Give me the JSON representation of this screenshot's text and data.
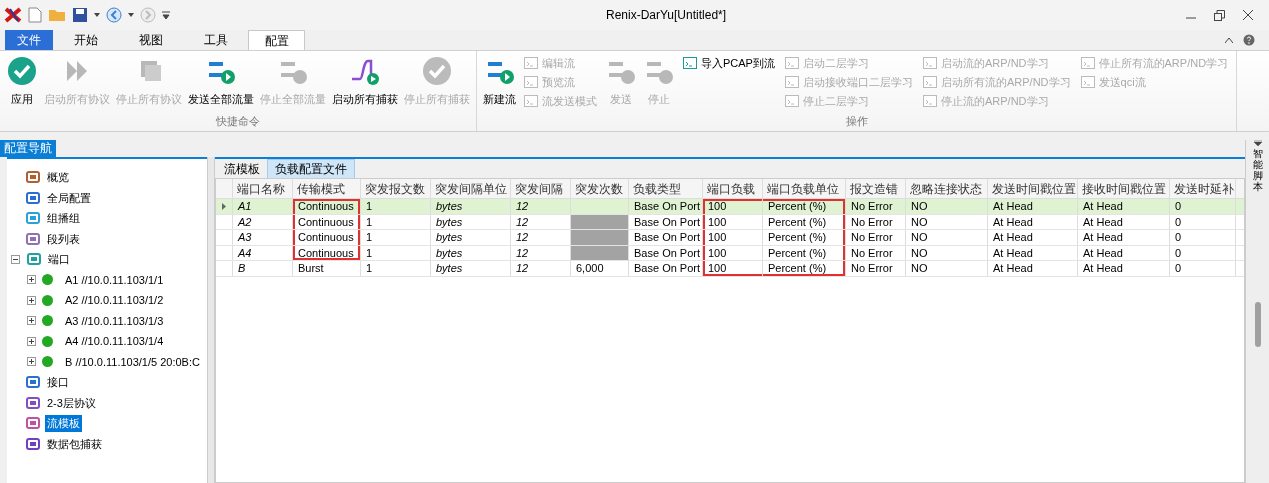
{
  "window": {
    "title": "Renix-DarYu[Untitled*]"
  },
  "ribbon_tabs": [
    {
      "label": "文件",
      "kind": "file",
      "selected": false
    },
    {
      "label": "开始",
      "kind": "tab",
      "selected": false
    },
    {
      "label": "视图",
      "kind": "tab",
      "selected": false
    },
    {
      "label": "工具",
      "kind": "tab",
      "selected": false
    },
    {
      "label": "配置",
      "kind": "tab",
      "selected": true
    }
  ],
  "ribbon_groups": [
    {
      "label": "快捷命令",
      "items": [
        {
          "kind": "large",
          "label": "应用",
          "disabled": false
        },
        {
          "kind": "large",
          "label": "启动所有协议",
          "disabled": true
        },
        {
          "kind": "large",
          "label": "停止所有协议",
          "disabled": true
        },
        {
          "kind": "large",
          "label": "发送全部流量",
          "disabled": false
        },
        {
          "kind": "large",
          "label": "停止全部流量",
          "disabled": true
        },
        {
          "kind": "large",
          "label": "启动所有捕获",
          "disabled": false
        },
        {
          "kind": "large",
          "label": "停止所有捕获",
          "disabled": true
        }
      ]
    },
    {
      "label": "操作",
      "items": [
        {
          "kind": "large",
          "label": "新建流",
          "disabled": false
        },
        {
          "kind": "column",
          "buttons": [
            {
              "label": "编辑流",
              "disabled": true
            },
            {
              "label": "预览流",
              "disabled": true
            },
            {
              "label": "流发送模式",
              "disabled": true
            }
          ]
        },
        {
          "kind": "large",
          "label": "发送",
          "disabled": true
        },
        {
          "kind": "large",
          "label": "停止",
          "disabled": true
        },
        {
          "kind": "column",
          "buttons": [
            {
              "label": "导入PCAP到流",
              "disabled": false
            }
          ]
        },
        {
          "kind": "column",
          "buttons": [
            {
              "label": "启动二层学习",
              "disabled": true
            },
            {
              "label": "启动接收端口二层学习",
              "disabled": true
            },
            {
              "label": "停止二层学习",
              "disabled": true
            }
          ]
        },
        {
          "kind": "column",
          "buttons": [
            {
              "label": "启动流的ARP/ND学习",
              "disabled": true
            },
            {
              "label": "启动所有流的ARP/ND学习",
              "disabled": true
            },
            {
              "label": "停止流的ARP/ND学习",
              "disabled": true
            }
          ]
        },
        {
          "kind": "column",
          "buttons": [
            {
              "label": "停止所有流的ARP/ND学习",
              "disabled": true
            },
            {
              "label": "发送qci流",
              "disabled": true
            }
          ]
        }
      ]
    }
  ],
  "nav": {
    "title": "配置导航",
    "items": [
      {
        "label": "概览",
        "selected": false
      },
      {
        "label": "全局配置",
        "selected": false
      },
      {
        "label": "组播组",
        "selected": false
      },
      {
        "label": "段列表",
        "selected": false
      },
      {
        "label": "端口",
        "selected": false,
        "expanded": true,
        "children": [
          {
            "label": "A1 //10.0.11.103/1/1",
            "color": "#22a822",
            "expanded": false
          },
          {
            "label": "A2 //10.0.11.103/1/2",
            "color": "#22a822",
            "expanded": false
          },
          {
            "label": "A3 //10.0.11.103/1/3",
            "color": "#22a822",
            "expanded": false
          },
          {
            "label": "A4 //10.0.11.103/1/4",
            "color": "#22a822",
            "expanded": false
          },
          {
            "label": "B //10.0.11.103/1/5 20:0B:C",
            "color": "#22a822",
            "expanded": false
          }
        ]
      },
      {
        "label": "接口",
        "selected": false
      },
      {
        "label": "2-3层协议",
        "selected": false
      },
      {
        "label": "流模板",
        "selected": true
      },
      {
        "label": "数据包捕获",
        "selected": false
      }
    ]
  },
  "doc_tabs": [
    {
      "label": "流模板",
      "selected": false
    },
    {
      "label": "负载配置文件",
      "selected": true
    }
  ],
  "table": {
    "columns": [
      {
        "label": "端口名称",
        "italic": true
      },
      {
        "label": "传输模式",
        "italic": false
      },
      {
        "label": "突发报文数",
        "italic": false
      },
      {
        "label": "突发间隔单位",
        "italic": true
      },
      {
        "label": "突发间隔",
        "italic": true
      },
      {
        "label": "突发次数",
        "italic": false
      },
      {
        "label": "负载类型",
        "italic": false
      },
      {
        "label": "端口负载",
        "italic": false
      },
      {
        "label": "端口负载单位",
        "italic": false
      },
      {
        "label": "报文造错",
        "italic": false
      },
      {
        "label": "忽略连接状态",
        "italic": false
      },
      {
        "label": "发送时间戳位置",
        "italic": false
      },
      {
        "label": "接收时间戳位置",
        "italic": false
      },
      {
        "label": "发送时延补",
        "italic": false
      }
    ],
    "rows": [
      {
        "selected": true,
        "cells": [
          {
            "text": "A1"
          },
          {
            "text": "Continuous",
            "marked": true
          },
          {
            "text": "1"
          },
          {
            "text": "bytes"
          },
          {
            "text": "12"
          },
          {
            "kind": "empty"
          },
          {
            "text": "Base On Port"
          },
          {
            "text": "100",
            "marked": true
          },
          {
            "text": "Percent (%)",
            "marked": true
          },
          {
            "text": "No Error"
          },
          {
            "text": "NO"
          },
          {
            "text": "At Head"
          },
          {
            "text": "At Head"
          },
          {
            "text": "0"
          }
        ]
      },
      {
        "selected": false,
        "cells": [
          {
            "text": "A2"
          },
          {
            "text": "Continuous",
            "marked": true
          },
          {
            "text": "1"
          },
          {
            "text": "bytes"
          },
          {
            "text": "12"
          },
          {
            "kind": "disabled"
          },
          {
            "text": "Base On Port"
          },
          {
            "text": "100",
            "marked": true
          },
          {
            "text": "Percent (%)",
            "marked": true
          },
          {
            "text": "No Error"
          },
          {
            "text": "NO"
          },
          {
            "text": "At Head"
          },
          {
            "text": "At Head"
          },
          {
            "text": "0"
          }
        ]
      },
      {
        "selected": false,
        "cells": [
          {
            "text": "A3"
          },
          {
            "text": "Continuous",
            "marked": true
          },
          {
            "text": "1"
          },
          {
            "text": "bytes"
          },
          {
            "text": "12"
          },
          {
            "kind": "disabled"
          },
          {
            "text": "Base On Port"
          },
          {
            "text": "100",
            "marked": true
          },
          {
            "text": "Percent (%)",
            "marked": true
          },
          {
            "text": "No Error"
          },
          {
            "text": "NO"
          },
          {
            "text": "At Head"
          },
          {
            "text": "At Head"
          },
          {
            "text": "0"
          }
        ]
      },
      {
        "selected": false,
        "cells": [
          {
            "text": "A4"
          },
          {
            "text": "Continuous",
            "marked": true
          },
          {
            "text": "1"
          },
          {
            "text": "bytes"
          },
          {
            "text": "12"
          },
          {
            "kind": "disabled"
          },
          {
            "text": "Base On Port"
          },
          {
            "text": "100",
            "marked": true
          },
          {
            "text": "Percent (%)",
            "marked": true
          },
          {
            "text": "No Error"
          },
          {
            "text": "NO"
          },
          {
            "text": "At Head"
          },
          {
            "text": "At Head"
          },
          {
            "text": "0"
          }
        ]
      },
      {
        "selected": false,
        "cells": [
          {
            "text": "B"
          },
          {
            "text": "Burst"
          },
          {
            "text": "1"
          },
          {
            "text": "bytes"
          },
          {
            "text": "12"
          },
          {
            "text": "6,000"
          },
          {
            "text": "Base On Port"
          },
          {
            "text": "100",
            "marked": true
          },
          {
            "text": "Percent (%)",
            "marked": true
          },
          {
            "text": "No Error"
          },
          {
            "text": "NO"
          },
          {
            "text": "At Head"
          },
          {
            "text": "At Head"
          },
          {
            "text": "0"
          }
        ]
      }
    ]
  },
  "side_panel": {
    "title": "智能脚本"
  }
}
